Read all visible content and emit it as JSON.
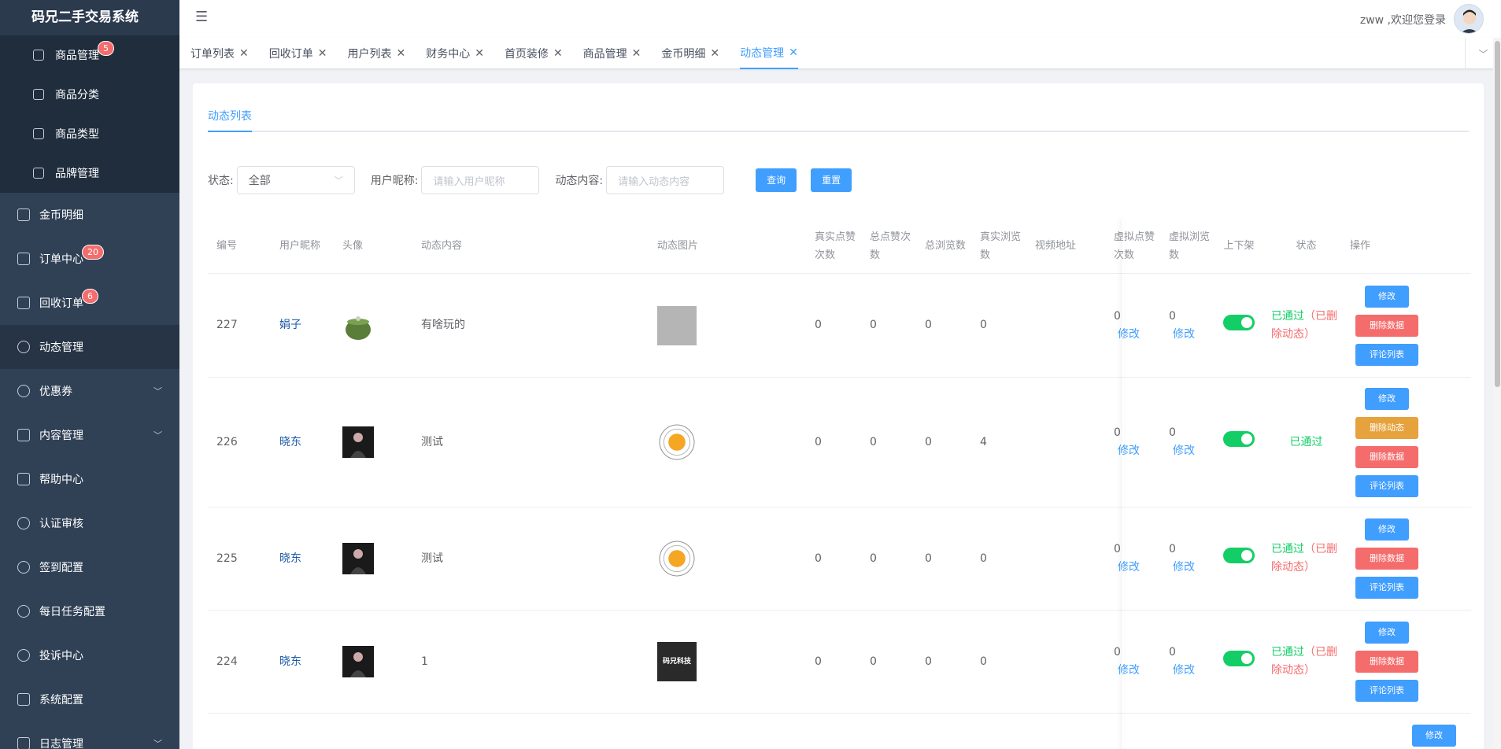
{
  "app": {
    "title": "码兄二手交易系统"
  },
  "sidebar": {
    "subitems": [
      {
        "label": "商品管理",
        "badge": "5"
      },
      {
        "label": "商品分类"
      },
      {
        "label": "商品类型"
      },
      {
        "label": "品牌管理"
      }
    ],
    "items": [
      {
        "label": "金币明细"
      },
      {
        "label": "订单中心",
        "badge": "20"
      },
      {
        "label": "回收订单",
        "badge": "6"
      },
      {
        "label": "动态管理"
      },
      {
        "label": "优惠券"
      },
      {
        "label": "内容管理"
      },
      {
        "label": "帮助中心"
      },
      {
        "label": "认证审核"
      },
      {
        "label": "签到配置"
      },
      {
        "label": "每日任务配置"
      },
      {
        "label": "投诉中心"
      },
      {
        "label": "系统配置"
      },
      {
        "label": "日志管理"
      }
    ]
  },
  "header": {
    "welcome": "zww ,欢迎您登录"
  },
  "tags": [
    {
      "label": "订单列表"
    },
    {
      "label": "回收订单"
    },
    {
      "label": "用户列表"
    },
    {
      "label": "财务中心"
    },
    {
      "label": "首页装修"
    },
    {
      "label": "商品管理"
    },
    {
      "label": "金币明细"
    },
    {
      "label": "动态管理"
    }
  ],
  "page": {
    "subtab": "动态列表",
    "filters": {
      "status_label": "状态:",
      "status_value": "全部",
      "nick_label": "用户昵称:",
      "nick_placeholder": "请输入用户昵称",
      "content_label": "动态内容:",
      "content_placeholder": "请输入动态内容",
      "search_btn": "查询",
      "reset_btn": "重置"
    },
    "columns": {
      "id": "编号",
      "nick": "用户昵称",
      "avatar": "头像",
      "content": "动态内容",
      "image": "动态图片",
      "real_like": "真实点赞次数",
      "total_like": "总点赞次数",
      "total_view": "总浏览数",
      "real_view": "真实浏览数",
      "video": "视频地址",
      "virt_like": "虚拟点赞次数",
      "virt_view": "虚拟浏览数",
      "shelf": "上下架",
      "status": "状态",
      "ops": "操作"
    },
    "edit_link": "修改",
    "ops_labels": {
      "edit": "修改",
      "del_dynamic": "删除动态",
      "del_data": "删除数据",
      "comments": "评论列表"
    },
    "rows": [
      {
        "id": "227",
        "nick": "娟子",
        "content": "有啥玩的",
        "real_like": "0",
        "total_like": "0",
        "total_view": "0",
        "real_view": "0",
        "virt_like": "0",
        "virt_view": "0",
        "status_ok": "已通过",
        "status_del": "（已删除动态）"
      },
      {
        "id": "226",
        "nick": "晓东",
        "content": "测试",
        "real_like": "0",
        "total_like": "0",
        "total_view": "0",
        "real_view": "4",
        "virt_like": "0",
        "virt_view": "0",
        "status_ok": "已通过",
        "status_del": ""
      },
      {
        "id": "225",
        "nick": "晓东",
        "content": "测试",
        "real_like": "0",
        "total_like": "0",
        "total_view": "0",
        "real_view": "0",
        "virt_like": "0",
        "virt_view": "0",
        "status_ok": "已通过",
        "status_del": "（已删除动态）"
      },
      {
        "id": "224",
        "nick": "晓东",
        "content": "1",
        "real_like": "0",
        "total_like": "0",
        "total_view": "0",
        "real_view": "0",
        "virt_like": "0",
        "virt_view": "0",
        "status_ok": "已通过",
        "status_del": "（已删除动态）",
        "image_text": "码兄科技"
      }
    ]
  },
  "colors": {
    "sidebar": "#304156",
    "primary": "#409eff",
    "danger": "#f56c6c",
    "warning": "#e6a23c",
    "success": "#13ce66"
  }
}
